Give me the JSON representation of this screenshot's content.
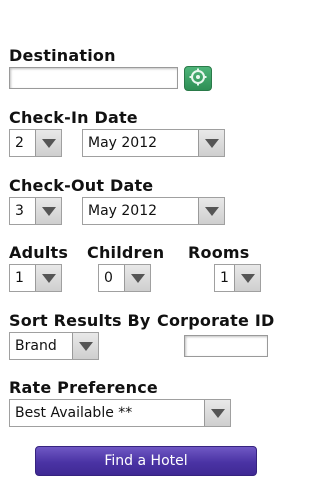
{
  "destination": {
    "label": "Destination",
    "value": "",
    "locate_icon": "crosshair-locate-icon"
  },
  "check_in": {
    "label": "Check-In Date",
    "day": "2",
    "month": "May 2012"
  },
  "check_out": {
    "label": "Check-Out Date",
    "day": "3",
    "month": "May 2012"
  },
  "guests": {
    "adults_label": "Adults",
    "adults_value": "1",
    "children_label": "Children",
    "children_value": "0",
    "rooms_label": "Rooms",
    "rooms_value": "1"
  },
  "sort": {
    "label": "Sort Results By",
    "value": "Brand"
  },
  "corporate": {
    "label": "Corporate ID",
    "value": ""
  },
  "rate": {
    "label": "Rate Preference",
    "value": "Best Available **"
  },
  "submit": {
    "label": "Find a Hotel"
  },
  "colors": {
    "locate_button": "#3a9f63",
    "submit_button": "#4a33a4"
  }
}
